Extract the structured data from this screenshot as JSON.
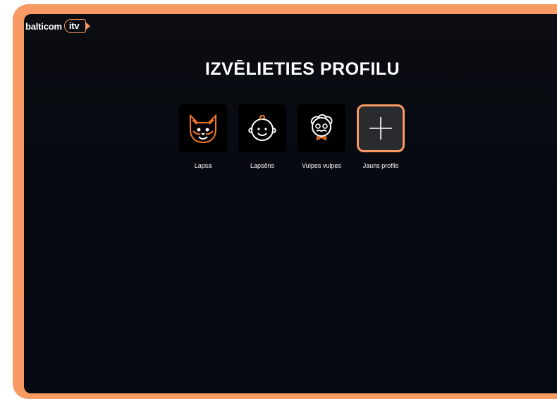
{
  "brand": {
    "name": "balticom",
    "badge": "itv"
  },
  "page": {
    "title": "IZVĒLIETIES PROFILU"
  },
  "profiles": [
    {
      "name": "Lapsa",
      "icon": "fox-icon"
    },
    {
      "name": "Lapsēns",
      "icon": "baby-icon"
    },
    {
      "name": "Vulpes vulpes",
      "icon": "grandpa-icon"
    },
    {
      "name": "Jauns profils",
      "icon": "plus-icon"
    }
  ],
  "colors": {
    "accent": "#f79a63",
    "background": "#05090f",
    "text": "#ffffff"
  }
}
